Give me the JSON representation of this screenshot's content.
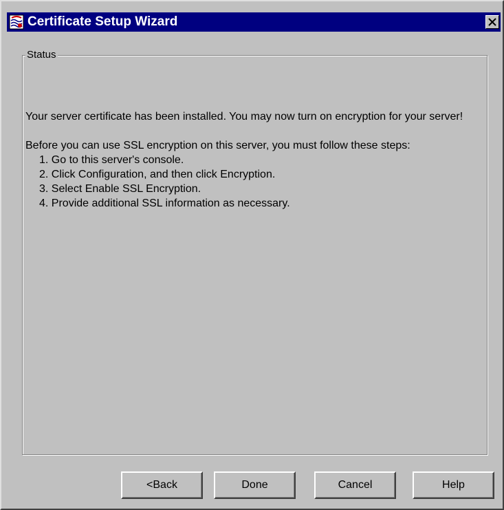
{
  "window": {
    "title": "Certificate Setup Wizard",
    "icon": "certificate-wizard-icon"
  },
  "status_group": {
    "label": "Status",
    "message": "Your server certificate has been installed. You may now turn on encryption for your server!",
    "instructions_intro": "Before you can use SSL encryption on this server, you must follow these steps:",
    "steps": [
      "1. Go to this server's console.",
      "2. Click Configuration, and then click Encryption.",
      "3. Select Enable SSL Encryption.",
      "4. Provide additional SSL information as necessary."
    ]
  },
  "buttons": {
    "back": "<Back",
    "done": "Done",
    "cancel": "Cancel",
    "help": "Help"
  },
  "colors": {
    "titlebar": "#000080",
    "dialog_face": "#c0c0c0"
  }
}
